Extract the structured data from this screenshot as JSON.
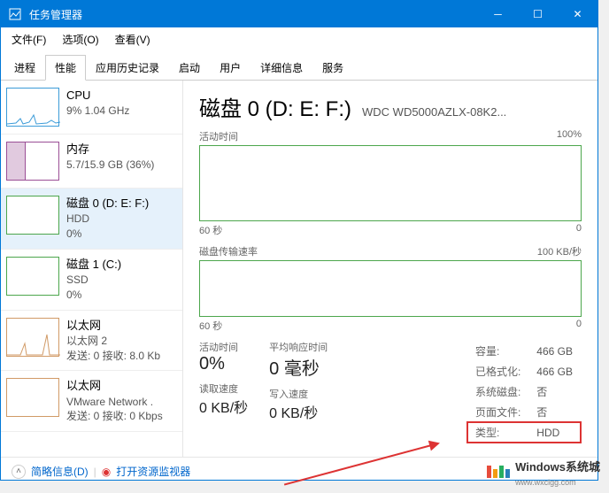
{
  "titlebar": {
    "title": "任务管理器"
  },
  "menu": {
    "file": "文件(F)",
    "options": "选项(O)",
    "view": "查看(V)"
  },
  "tabs": {
    "processes": "进程",
    "performance": "性能",
    "apphistory": "应用历史记录",
    "startup": "启动",
    "users": "用户",
    "details": "详细信息",
    "services": "服务"
  },
  "sidebar": {
    "cpu": {
      "title": "CPU",
      "sub": "9% 1.04 GHz"
    },
    "mem": {
      "title": "内存",
      "sub": "5.7/15.9 GB (36%)"
    },
    "disk0": {
      "title": "磁盘 0 (D: E: F:)",
      "sub1": "HDD",
      "sub2": "0%"
    },
    "disk1": {
      "title": "磁盘 1 (C:)",
      "sub1": "SSD",
      "sub2": "0%"
    },
    "eth0": {
      "title": "以太网",
      "sub1": "以太网 2",
      "sub2": "发送: 0 接收: 8.0 Kb"
    },
    "eth1": {
      "title": "以太网",
      "sub1": "VMware Network .",
      "sub2": "发送: 0 接收: 0 Kbps"
    }
  },
  "main": {
    "title": "磁盘 0 (D: E: F:)",
    "model": "WDC WD5000AZLX-08K2...",
    "chart1": {
      "label": "活动时间",
      "max": "100%",
      "xaxis": "60 秒",
      "xaxis_end": "0"
    },
    "chart2": {
      "label": "磁盘传输速率",
      "max": "100 KB/秒",
      "xaxis": "60 秒",
      "xaxis_end": "0"
    },
    "stats": {
      "active_label": "活动时间",
      "active_value": "0%",
      "resp_label": "平均响应时间",
      "resp_value": "0 毫秒",
      "read_label": "读取速度",
      "read_value": "0 KB/秒",
      "write_label": "写入速度",
      "write_value": "0 KB/秒"
    },
    "right": {
      "capacity_l": "容量:",
      "capacity_v": "466 GB",
      "formatted_l": "已格式化:",
      "formatted_v": "466 GB",
      "sysdisk_l": "系统磁盘:",
      "sysdisk_v": "否",
      "pagefile_l": "页面文件:",
      "pagefile_v": "否",
      "type_l": "类型:",
      "type_v": "HDD"
    }
  },
  "footer": {
    "brief": "简略信息(D)",
    "resmon": "打开资源监视器"
  },
  "watermark": {
    "brand": "Windows系统城",
    "url": "www.wxclgg.com"
  },
  "chart_data": {
    "type": "line",
    "charts": [
      {
        "name": "活动时间",
        "ylim": [
          0,
          100
        ],
        "unit": "%",
        "x_range_seconds": 60,
        "values": [
          0,
          0,
          0,
          0,
          0,
          0,
          0,
          0,
          0,
          0,
          0,
          0
        ]
      },
      {
        "name": "磁盘传输速率",
        "ylim": [
          0,
          100
        ],
        "unit": "KB/秒",
        "x_range_seconds": 60,
        "values": [
          0,
          0,
          0,
          0,
          0,
          0,
          0,
          0,
          0,
          0,
          0,
          0
        ]
      }
    ]
  }
}
